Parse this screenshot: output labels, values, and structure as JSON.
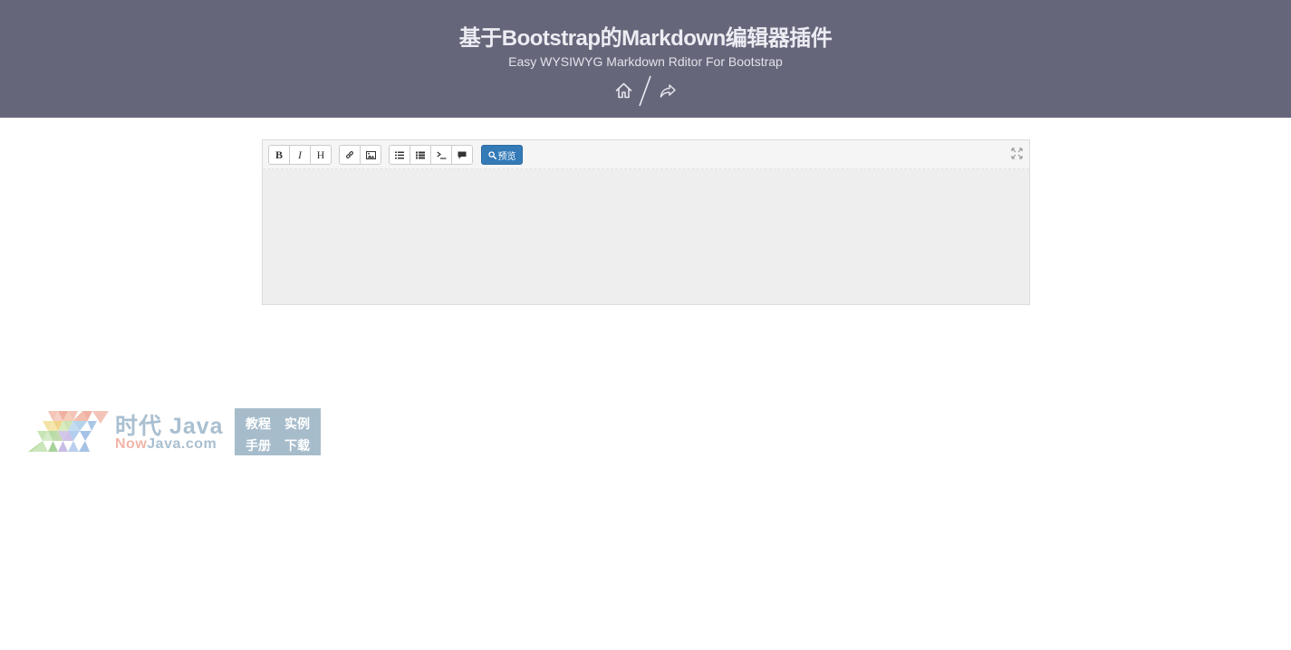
{
  "header": {
    "title": "基于Bootstrap的Markdown编辑器插件",
    "subtitle": "Easy WYSIWYG Markdown Rditor For Bootstrap",
    "nav": {
      "home_icon": "home-icon",
      "separator": "/",
      "share_icon": "share-icon"
    }
  },
  "editor": {
    "toolbar": {
      "groups": [
        [
          {
            "name": "bold",
            "label": "B"
          },
          {
            "name": "italic",
            "label": "I"
          },
          {
            "name": "heading",
            "label": "H"
          }
        ],
        [
          {
            "name": "link",
            "icon": "link-icon"
          },
          {
            "name": "image",
            "icon": "image-icon"
          }
        ],
        [
          {
            "name": "unordered-list",
            "icon": "list-icon"
          },
          {
            "name": "ordered-list",
            "icon": "ordered-list-icon"
          },
          {
            "name": "code",
            "icon": "code-icon"
          },
          {
            "name": "quote",
            "icon": "comment-icon"
          }
        ]
      ],
      "preview_label": "预览",
      "preview_icon": "search-icon",
      "fullscreen_icon": "fullscreen-icon"
    },
    "content": ""
  },
  "watermark": {
    "brand": "时代 Java",
    "domain_prefix": "Now",
    "domain_suffix": "Java.com",
    "links": [
      "教程",
      "实例",
      "手册",
      "下载"
    ]
  },
  "colors": {
    "header_bg": "#66667b",
    "primary_button": "#337ab7",
    "editor_bg": "#eeeeee"
  }
}
